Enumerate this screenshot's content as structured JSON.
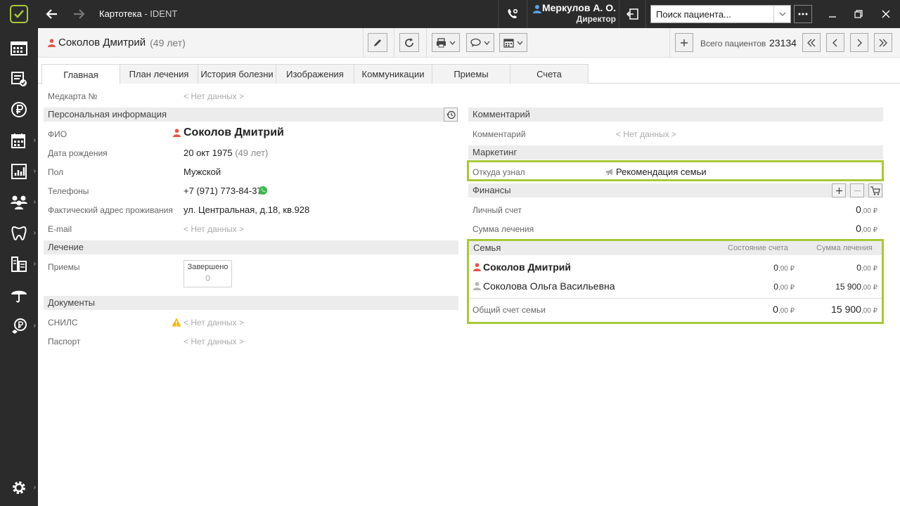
{
  "window": {
    "title": "Картотека",
    "app_name": " - IDENT",
    "user_name": "Меркулов А. О.",
    "user_role": "Директор",
    "search_placeholder": "Поиск пациента..."
  },
  "header": {
    "patient_name": "Соколов Дмитрий",
    "patient_age": "(49 лет)",
    "total_label": "Всего пациентов",
    "total_value": "23134"
  },
  "tabs": [
    {
      "label": "Главная",
      "active": true
    },
    {
      "label": "План лечения"
    },
    {
      "label": "История болезни"
    },
    {
      "label": "Изображения"
    },
    {
      "label": "Коммуникации"
    },
    {
      "label": "Приемы"
    },
    {
      "label": "Счета"
    }
  ],
  "no_data": "< Нет данных >",
  "left": {
    "medcard_label": "Медкарта №",
    "personal_title": "Персональная информация",
    "fio_label": "ФИО",
    "fio_value": "Соколов Дмитрий",
    "birth_label": "Дата рождения",
    "birth_value": "20 окт 1975",
    "birth_age": "(49 лет)",
    "gender_label": "Пол",
    "gender_value": "Мужской",
    "phones_label": "Телефоны",
    "phones_value": "+7 (971) 773-84-37",
    "address_label": "Фактический адрес проживания",
    "address_value": "ул. Центральная, д.18, кв.928",
    "email_label": "E-mail",
    "treatment_title": "Лечение",
    "visits_label": "Приемы",
    "visits_status": "Завершено",
    "visits_count": "0",
    "documents_title": "Документы",
    "snils_label": "СНИЛС",
    "passport_label": "Паспорт"
  },
  "right": {
    "comment_title": "Комментарий",
    "comment_label": "Комментарий",
    "marketing_title": "Маркетинг",
    "source_label": "Откуда узнал",
    "source_value": "Рекомендация семьи",
    "finance_title": "Финансы",
    "account_label": "Личный счет",
    "account_int": "0",
    "account_dec": ",00 ₽",
    "treatment_sum_label": "Сумма лечения",
    "treatment_sum_int": "0",
    "treatment_sum_dec": ",00 ₽",
    "family_title": "Семья",
    "family_col_account": "Состояние счета",
    "family_col_sum": "Сумма лечения",
    "family_members": [
      {
        "name": "Соколов Дмитрий",
        "account_int": "0",
        "account_dec": ",00 ₽",
        "sum_int": "0",
        "sum_dec": ",00 ₽"
      },
      {
        "name": "Соколова Ольга Васильевна",
        "account_int": "0",
        "account_dec": ",00 ₽",
        "sum_int": "15 900",
        "sum_dec": ",00 ₽"
      }
    ],
    "family_total_label": "Общий счет семьи",
    "family_total_account_int": "0",
    "family_total_account_dec": ",00 ₽",
    "family_total_sum_int": "15 900",
    "family_total_sum_dec": ",00 ₽"
  },
  "colors": {
    "accent_green": "#a8c83a",
    "dark_bg": "#2b2b2b",
    "male_icon": "#e5534b",
    "female_icon": "#b5b5b5"
  }
}
